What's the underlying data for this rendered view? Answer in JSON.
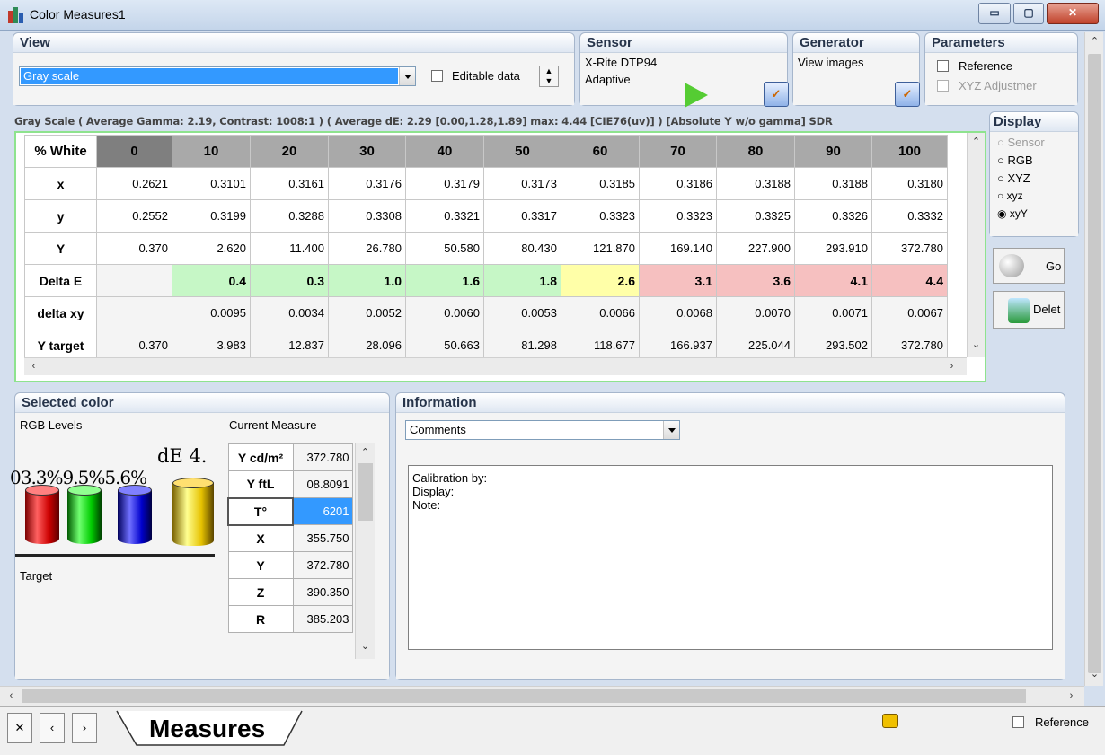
{
  "window": {
    "title": "Color Measures1"
  },
  "view": {
    "heading": "View",
    "mode_value": "Gray scale",
    "editable_label": "Editable data"
  },
  "sensor": {
    "heading": "Sensor",
    "name": "X-Rite DTP94",
    "mode": "Adaptive"
  },
  "generator": {
    "heading": "Generator",
    "text": "View images"
  },
  "parameters": {
    "heading": "Parameters",
    "reference_label": "Reference",
    "xyz_adjust_label": "XYZ Adjustmer"
  },
  "grid": {
    "caption": "Gray Scale ( Average Gamma: 2.19, Contrast: 1008:1 ) ( Average dE: 2.29 [0.00,1.28,1.89] max: 4.44 [CIE76(uv)] ) [Absolute Y w/o gamma] SDR",
    "header_label": "% White",
    "columns": [
      "0",
      "10",
      "20",
      "30",
      "40",
      "50",
      "60",
      "70",
      "80",
      "90",
      "100"
    ],
    "rows": [
      {
        "label": "x",
        "values": [
          "0.2621",
          "0.3101",
          "0.3161",
          "0.3176",
          "0.3179",
          "0.3173",
          "0.3185",
          "0.3186",
          "0.3188",
          "0.3188",
          "0.3180"
        ]
      },
      {
        "label": "y",
        "values": [
          "0.2552",
          "0.3199",
          "0.3288",
          "0.3308",
          "0.3321",
          "0.3317",
          "0.3323",
          "0.3323",
          "0.3325",
          "0.3326",
          "0.3332"
        ]
      },
      {
        "label": "Y",
        "values": [
          "0.370",
          "2.620",
          "11.400",
          "26.780",
          "50.580",
          "80.430",
          "121.870",
          "169.140",
          "227.900",
          "293.910",
          "372.780"
        ]
      },
      {
        "label": "Delta E",
        "values": [
          "",
          "0.4",
          "0.3",
          "1.0",
          "1.6",
          "1.8",
          "2.6",
          "3.1",
          "3.6",
          "4.1",
          "4.4"
        ]
      },
      {
        "label": "delta xy",
        "values": [
          "",
          "0.0095",
          "0.0034",
          "0.0052",
          "0.0060",
          "0.0053",
          "0.0066",
          "0.0068",
          "0.0070",
          "0.0071",
          "0.0067"
        ]
      },
      {
        "label": "Y target",
        "values": [
          "0.370",
          "3.983",
          "12.837",
          "28.096",
          "50.663",
          "81.298",
          "118.677",
          "166.937",
          "225.044",
          "293.502",
          "372.780"
        ]
      }
    ],
    "delta_e_colors": [
      "none",
      "green",
      "green",
      "green",
      "green",
      "green",
      "yellow",
      "red",
      "red",
      "red",
      "red"
    ]
  },
  "display": {
    "heading": "Display",
    "options": [
      "Sensor",
      "RGB",
      "XYZ",
      "xyz",
      "xyY"
    ],
    "selected": "xyY",
    "go_label": "Go",
    "delete_label": "Delet"
  },
  "selected_color": {
    "heading": "Selected color",
    "rgb_levels_label": "RGB Levels",
    "current_measure_label": "Current Measure",
    "de_text": "dE 4.",
    "percent_text": "03.3%9.5%5.6%",
    "target_label": "Target",
    "measures": [
      {
        "key": "Y cd/m²",
        "value": "372.780"
      },
      {
        "key": "Y ftL",
        "value": "08.8091"
      },
      {
        "key": "T°",
        "value": "6201"
      },
      {
        "key": "X",
        "value": "355.750"
      },
      {
        "key": "Y",
        "value": "372.780"
      },
      {
        "key": "Z",
        "value": "390.350"
      },
      {
        "key": "R",
        "value": "385.203"
      }
    ]
  },
  "information": {
    "heading": "Information",
    "dropdown_value": "Comments",
    "notes": "Calibration by:\nDisplay:\nNote:"
  },
  "footer": {
    "tab_label": "Measures",
    "reference_label": "Reference"
  },
  "colors": {
    "selection_blue": "#3399ff",
    "green_border": "#8ee38e"
  }
}
